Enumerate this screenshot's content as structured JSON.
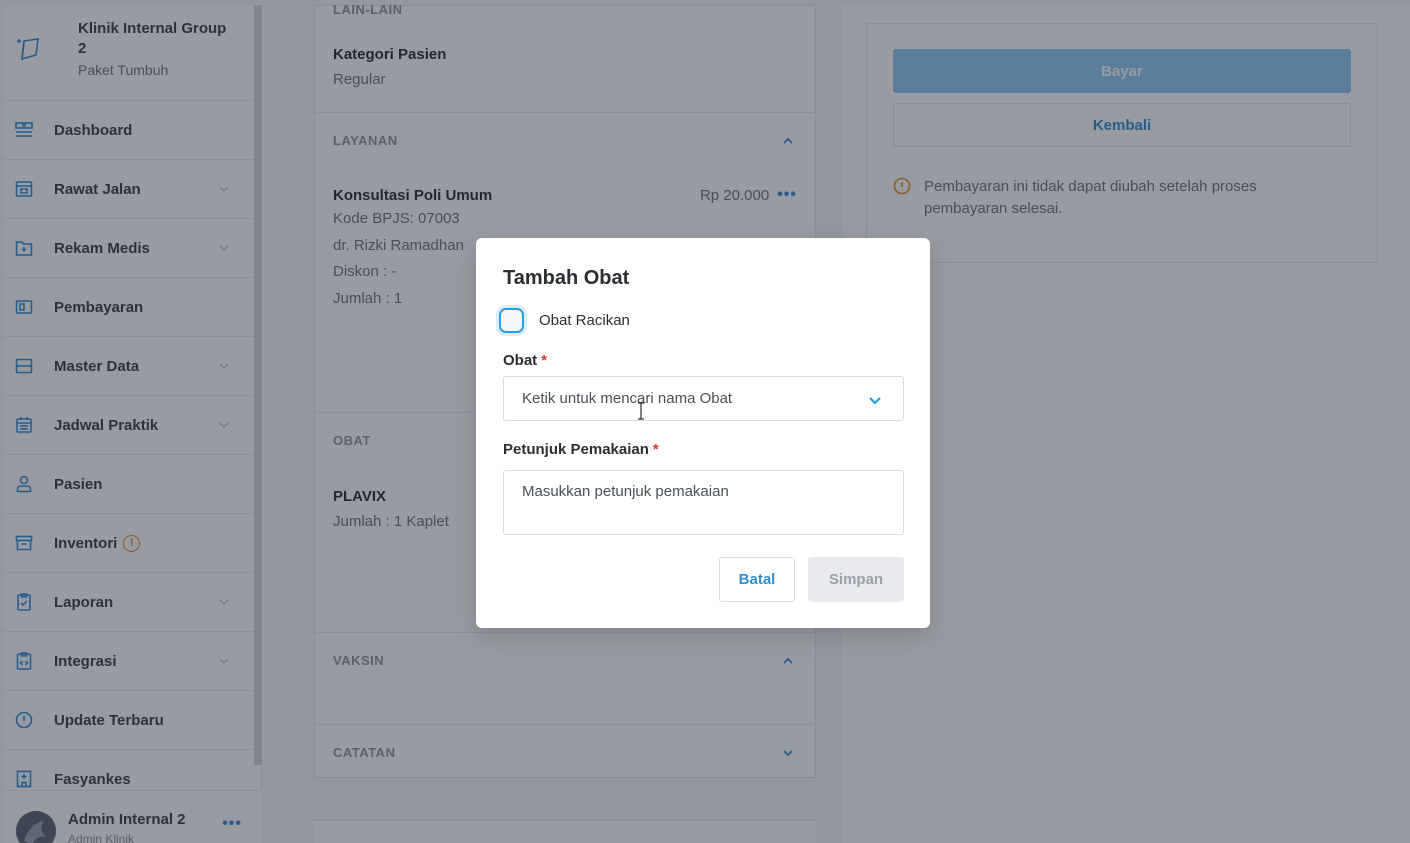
{
  "sidebar": {
    "clinic_name": "Klinik Internal Group 2",
    "clinic_plan": "Paket Tumbuh",
    "items": [
      {
        "label": "Dashboard",
        "icon": "dashboard-icon"
      },
      {
        "label": "Rawat Jalan",
        "icon": "outpatient-icon"
      },
      {
        "label": "Rekam Medis",
        "icon": "medical-record-icon"
      },
      {
        "label": "Pembayaran",
        "icon": "payment-icon"
      },
      {
        "label": "Master Data",
        "icon": "master-data-icon"
      },
      {
        "label": "Jadwal Praktik",
        "icon": "calendar-icon"
      },
      {
        "label": "Pasien",
        "icon": "user-icon"
      },
      {
        "label": "Inventori",
        "icon": "archive-icon"
      },
      {
        "label": "Laporan",
        "icon": "report-icon"
      },
      {
        "label": "Integrasi",
        "icon": "integration-icon"
      },
      {
        "label": "Update Terbaru",
        "icon": "info-icon"
      },
      {
        "label": "Fasyankes",
        "icon": "hospital-icon"
      }
    ],
    "user": {
      "name": "Admin Internal 2",
      "role": "Admin Klinik",
      "more": "•••"
    }
  },
  "main": {
    "lain_lain_label": "LAIN-LAIN",
    "kategori_title": "Kategori Pasien",
    "kategori_value": "Regular",
    "layanan_label": "LAYANAN",
    "service": {
      "name": "Konsultasi Poli Umum",
      "price": "Rp 20.000",
      "more": "•••",
      "kode": "Kode BPJS: 07003",
      "dokter": "dr. Rizki Ramadhan",
      "diskon": "Diskon : -",
      "jumlah": "Jumlah : 1"
    },
    "obat_label": "OBAT",
    "drug": {
      "name": "PLAVIX",
      "jumlah": "Jumlah : 1 Kaplet"
    },
    "vaksin_label": "VAKSIN",
    "catatan_label": "CATATAN"
  },
  "payment": {
    "bayar_label": "Bayar",
    "kembali_label": "Kembali",
    "notice": "Pembayaran ini tidak dapat diubah setelah proses pembayaran selesai."
  },
  "modal": {
    "title": "Tambah Obat",
    "racikan_label": "Obat Racikan",
    "obat_label": "Obat",
    "required_mark": "*",
    "obat_placeholder": "Ketik untuk mencari nama Obat",
    "petunjuk_label": "Petunjuk Pemakaian",
    "petunjuk_placeholder": "Masukkan petunjuk pemakaian",
    "batal_label": "Batal",
    "simpan_label": "Simpan"
  },
  "colors": {
    "accent": "#2f8fd1",
    "required": "#e0302f",
    "warning": "#e48a1b",
    "overlay": "#1c2230"
  }
}
